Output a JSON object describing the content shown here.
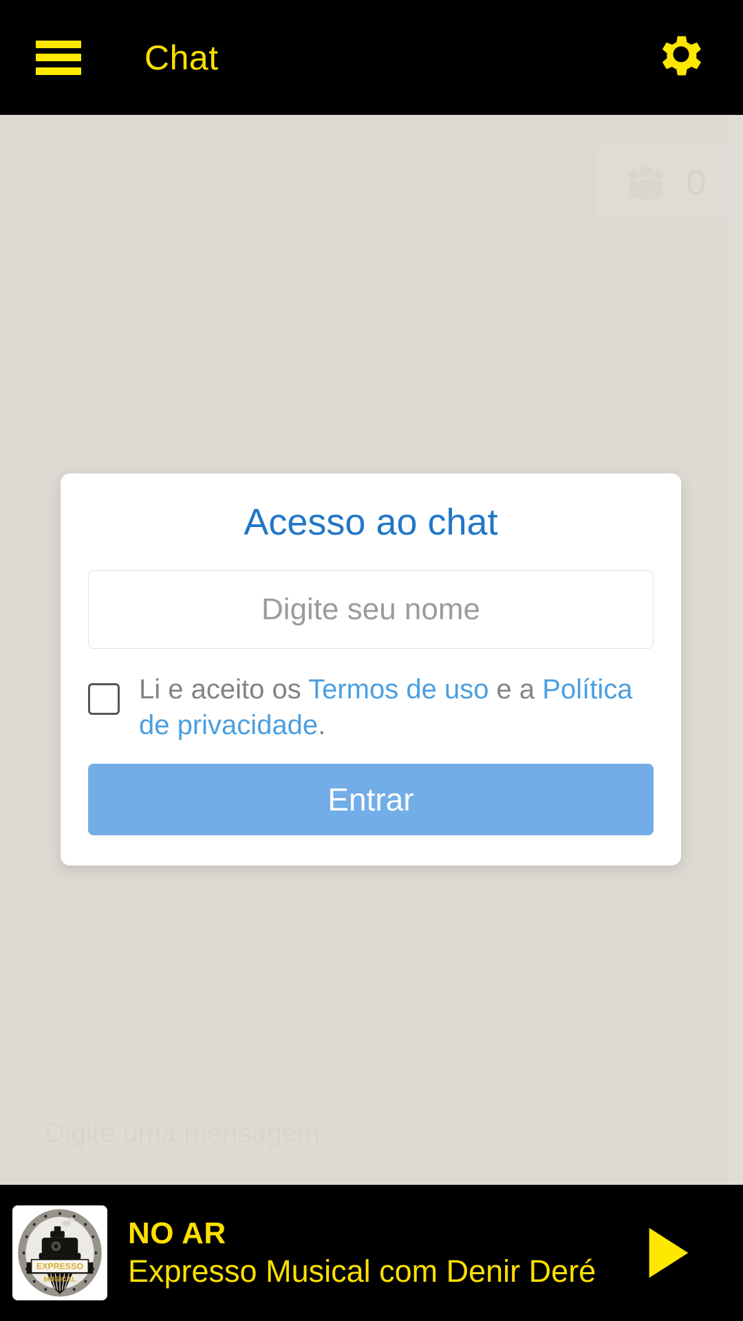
{
  "colors": {
    "header_bg": "#000000",
    "accent_yellow": "#ffe000",
    "page_bg": "#ded9d3",
    "modal_bg": "#ffffff",
    "title_blue": "#2176c7",
    "link_blue": "#4a9fe0",
    "button_blue": "#72ade8",
    "muted_text": "#838383"
  },
  "header": {
    "menu_icon": "hamburger-menu-icon",
    "title": "Chat",
    "settings_icon": "gear-icon"
  },
  "chat": {
    "users_badge": {
      "icon": "users-group-icon",
      "count": "0"
    },
    "composer": {
      "placeholder": "Digite uma mensagem",
      "value": "",
      "send_label": "Enviar"
    }
  },
  "modal": {
    "title": "Acesso ao chat",
    "name_input": {
      "placeholder": "Digite seu nome",
      "value": ""
    },
    "terms": {
      "checked": false,
      "prefix": "Li e aceito os ",
      "terms_link": "Termos de uso",
      "middle": " e a ",
      "privacy_link": "Política de privacidade",
      "suffix": "."
    },
    "submit_label": "Entrar"
  },
  "player": {
    "album_art": {
      "icon": "train-logo-icon",
      "banner_text": "EXPRESSO",
      "sub_text": "MUSICAL"
    },
    "status": "NO AR",
    "program": "Expresso Musical com Denir Deré",
    "play_icon": "play-icon"
  }
}
